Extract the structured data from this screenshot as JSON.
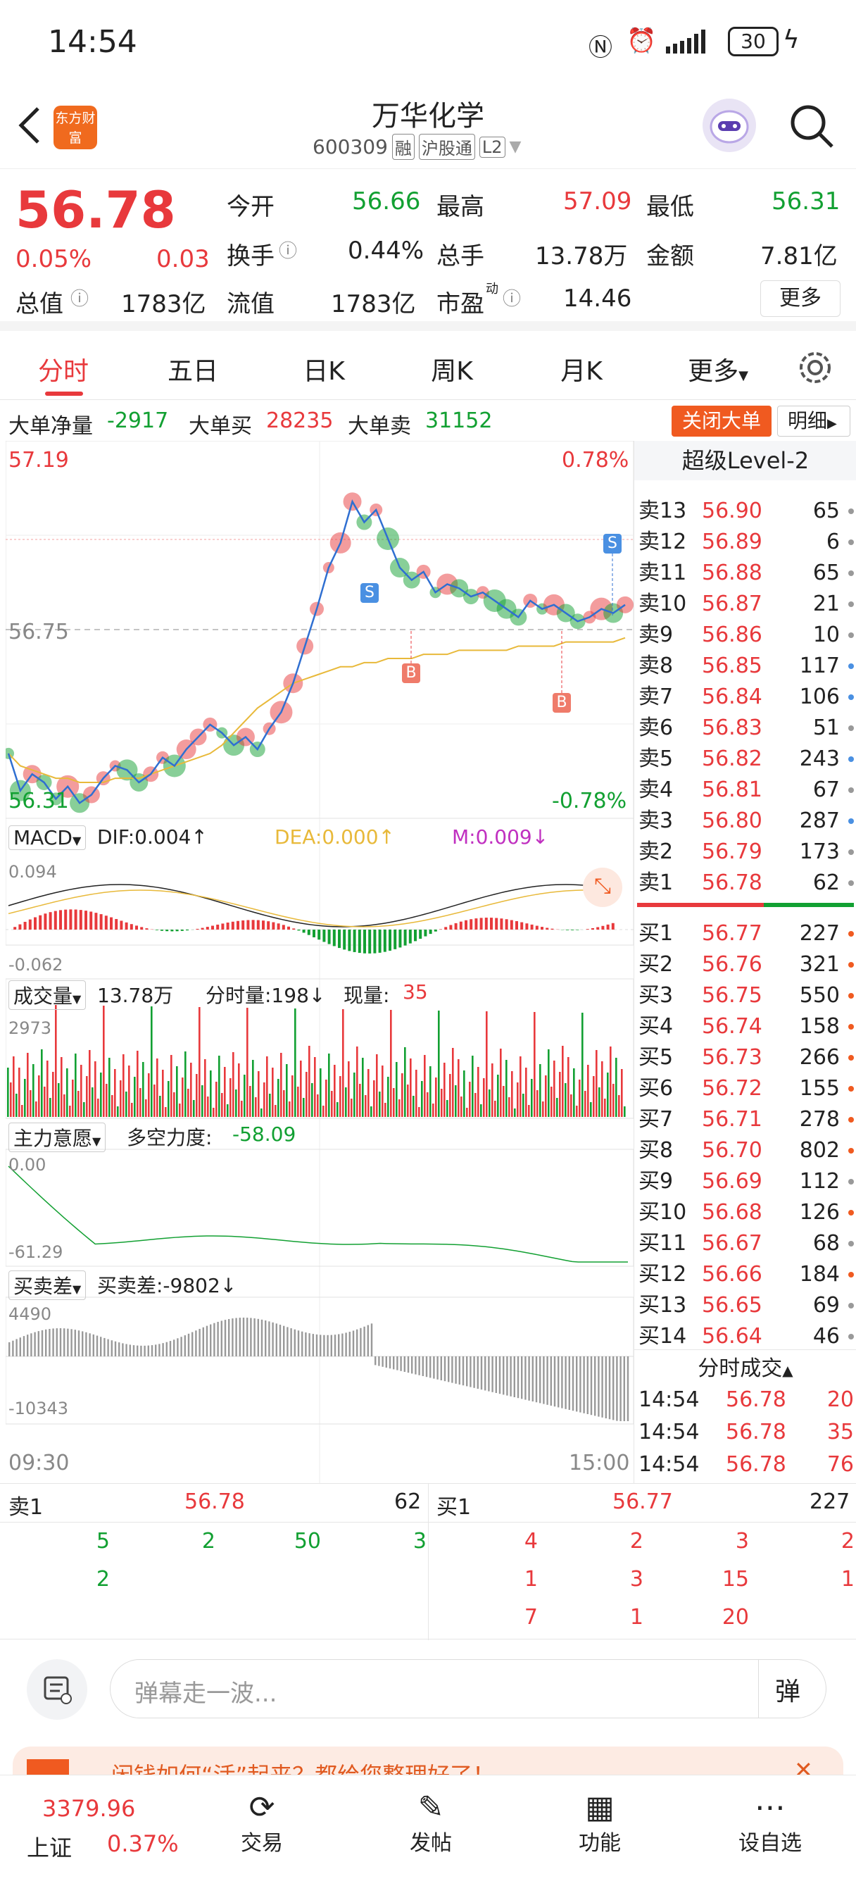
{
  "status_bar": {
    "time": "14:54",
    "battery": "30"
  },
  "header": {
    "logo_text": "东方财富",
    "stock_name": "万华化学",
    "stock_code": "600309",
    "tag_rong": "融",
    "tag_hgt": "沪股通",
    "tag_level": "L2"
  },
  "quote": {
    "price": "56.78",
    "change_pct": "0.05%",
    "change": "0.03",
    "open_label": "今开",
    "open": "56.66",
    "high_label": "最高",
    "high": "57.09",
    "low_label": "最低",
    "low": "56.31",
    "turnover_label": "换手",
    "turnover": "0.44%",
    "volume_label": "总手",
    "volume": "13.78万",
    "amount_label": "金额",
    "amount": "7.81亿",
    "mktcap_label": "总值",
    "mktcap": "1783亿",
    "float_label": "流值",
    "float": "1783亿",
    "pe_label": "市盈",
    "pe_sup": "动",
    "pe": "14.46",
    "more": "更多"
  },
  "tabs": [
    "分时",
    "五日",
    "日K",
    "周K",
    "月K",
    "更多"
  ],
  "big_order": {
    "net_label": "大单净量",
    "net": "-2917",
    "buy_label": "大单买",
    "buy": "28235",
    "sell_label": "大单卖",
    "sell": "31152",
    "close_btn": "关闭大单",
    "detail_btn": "明细"
  },
  "chart": {
    "y_top": "57.19",
    "y_top_pct": "0.78%",
    "y_bottom": "56.31",
    "y_bottom_pct": "-0.78%",
    "y_mid": "56.75",
    "marker_b": "B",
    "marker_s": "S",
    "macd": {
      "label": "MACD",
      "dif": "DIF:0.004↑",
      "dea": "DEA:0.000↑",
      "m": "M:0.009↓",
      "top": "0.094",
      "bottom": "-0.062"
    },
    "volume": {
      "label": "成交量",
      "total": "13.78万",
      "tick": "分时量:198↓",
      "now_label": "现量:",
      "now": "35",
      "top": "2973"
    },
    "main": {
      "label": "主力意愿",
      "power_label": "多空力度:",
      "power": "-58.09",
      "top": "0.00",
      "bottom": "-61.29"
    },
    "diff": {
      "label": "买卖差",
      "value": "买卖差:-9802↓",
      "top": "4490",
      "bottom": "-10343"
    },
    "time_start": "09:30",
    "time_end": "15:00",
    "colors": {
      "up": "#e8393c",
      "down": "#12a032",
      "avg": "#e8b93a"
    }
  },
  "chart_data": {
    "type": "line",
    "title": "",
    "ylim": [
      56.31,
      57.19
    ],
    "price": [
      56.45,
      56.36,
      56.4,
      56.38,
      56.34,
      56.37,
      56.33,
      56.35,
      56.39,
      56.42,
      56.41,
      56.38,
      56.4,
      56.44,
      56.42,
      56.46,
      56.49,
      56.52,
      56.5,
      56.47,
      56.49,
      56.46,
      56.51,
      56.55,
      56.62,
      56.71,
      56.8,
      56.9,
      56.96,
      57.06,
      57.01,
      57.04,
      56.97,
      56.9,
      56.87,
      56.89,
      56.84,
      56.86,
      56.85,
      56.83,
      56.84,
      56.82,
      56.8,
      56.78,
      56.82,
      56.8,
      56.81,
      56.79,
      56.77,
      56.78,
      56.8,
      56.79,
      56.81
    ],
    "avg": [
      56.45,
      56.42,
      56.41,
      56.4,
      56.39,
      56.39,
      56.38,
      56.38,
      56.38,
      56.39,
      56.39,
      56.39,
      56.4,
      56.41,
      56.42,
      56.43,
      56.44,
      56.45,
      56.47,
      56.5,
      56.53,
      56.56,
      56.58,
      56.6,
      56.62,
      56.63,
      56.64,
      56.65,
      56.66,
      56.66,
      56.67,
      56.67,
      56.68,
      56.68,
      56.68,
      56.69,
      56.69,
      56.69,
      56.7,
      56.7,
      56.7,
      56.7,
      56.7,
      56.71,
      56.71,
      56.71,
      56.71,
      56.72,
      56.72,
      56.72,
      56.72,
      56.72,
      56.73
    ]
  },
  "order_book": {
    "title": "超级Level-2",
    "sells": [
      {
        "lv": "卖13",
        "price": "56.90",
        "vol": "65"
      },
      {
        "lv": "卖12",
        "price": "56.89",
        "vol": "6"
      },
      {
        "lv": "卖11",
        "price": "56.88",
        "vol": "65"
      },
      {
        "lv": "卖10",
        "price": "56.87",
        "vol": "21"
      },
      {
        "lv": "卖9",
        "price": "56.86",
        "vol": "10"
      },
      {
        "lv": "卖8",
        "price": "56.85",
        "vol": "117"
      },
      {
        "lv": "卖7",
        "price": "56.84",
        "vol": "106"
      },
      {
        "lv": "卖6",
        "price": "56.83",
        "vol": "51"
      },
      {
        "lv": "卖5",
        "price": "56.82",
        "vol": "243"
      },
      {
        "lv": "卖4",
        "price": "56.81",
        "vol": "67"
      },
      {
        "lv": "卖3",
        "price": "56.80",
        "vol": "287"
      },
      {
        "lv": "卖2",
        "price": "56.79",
        "vol": "173"
      },
      {
        "lv": "卖1",
        "price": "56.78",
        "vol": "62"
      }
    ],
    "buys": [
      {
        "lv": "买1",
        "price": "56.77",
        "vol": "227"
      },
      {
        "lv": "买2",
        "price": "56.76",
        "vol": "321"
      },
      {
        "lv": "买3",
        "price": "56.75",
        "vol": "550"
      },
      {
        "lv": "买4",
        "price": "56.74",
        "vol": "158"
      },
      {
        "lv": "买5",
        "price": "56.73",
        "vol": "266"
      },
      {
        "lv": "买6",
        "price": "56.72",
        "vol": "155"
      },
      {
        "lv": "买7",
        "price": "56.71",
        "vol": "278"
      },
      {
        "lv": "买8",
        "price": "56.70",
        "vol": "802"
      },
      {
        "lv": "买9",
        "price": "56.69",
        "vol": "112"
      },
      {
        "lv": "买10",
        "price": "56.68",
        "vol": "126"
      },
      {
        "lv": "买11",
        "price": "56.67",
        "vol": "68"
      },
      {
        "lv": "买12",
        "price": "56.66",
        "vol": "184"
      },
      {
        "lv": "买13",
        "price": "56.65",
        "vol": "69"
      },
      {
        "lv": "买14",
        "price": "56.64",
        "vol": "46"
      }
    ],
    "ticks_title": "分时成交",
    "ticks": [
      {
        "time": "14:54",
        "price": "56.78",
        "vol": "20"
      },
      {
        "time": "14:54",
        "price": "56.78",
        "vol": "35"
      },
      {
        "time": "14:54",
        "price": "56.78",
        "vol": "76"
      }
    ]
  },
  "queue": {
    "sell_label": "卖1",
    "sell_price": "56.78",
    "sell_vol": "62",
    "buy_label": "买1",
    "buy_price": "56.77",
    "buy_vol": "227",
    "sell_row1": [
      "5",
      "2",
      "50",
      "3"
    ],
    "sell_row2": [
      "2"
    ],
    "buy_row1": [
      "4",
      "2",
      "3",
      "2"
    ],
    "buy_row2": [
      "1",
      "3",
      "15",
      "1"
    ],
    "buy_row3": [
      "7",
      "1",
      "20"
    ]
  },
  "chat": {
    "placeholder": "弹幕走一波...",
    "danmu_btn": "弹",
    "banner": "闲钱如何“活”起来？都给您整理好了！"
  },
  "nav": {
    "index_value": "3379.96",
    "index_name": "上证",
    "index_pct": "0.37%",
    "trade": "交易",
    "post": "发帖",
    "func": "功能",
    "watch": "设自选"
  }
}
